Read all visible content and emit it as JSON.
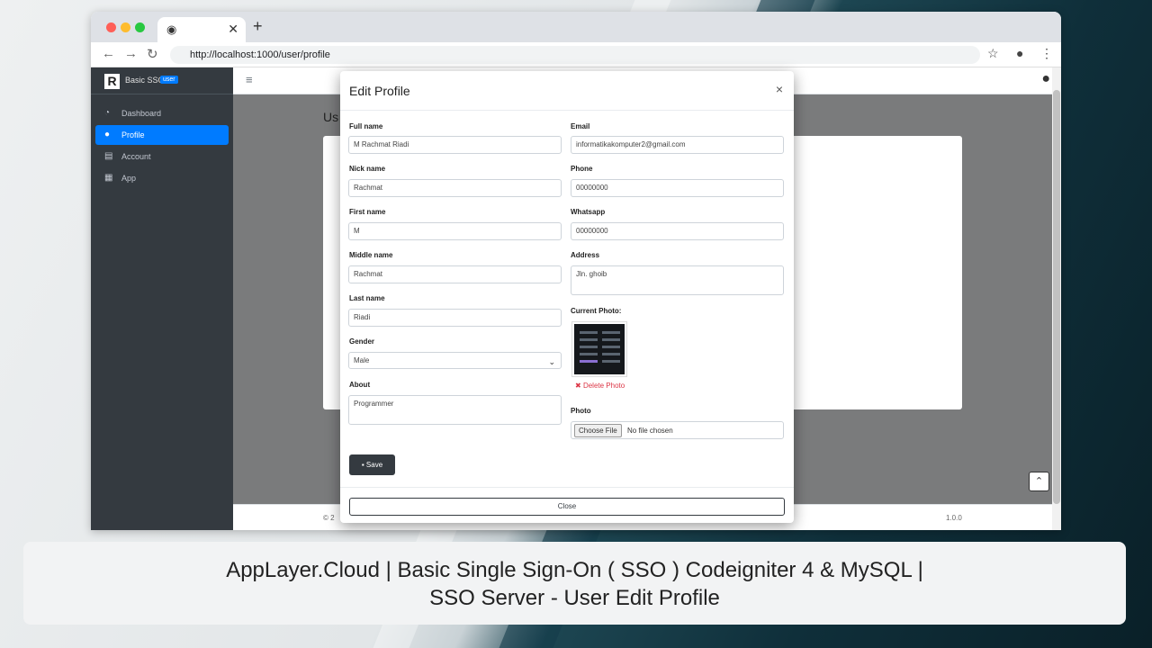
{
  "browser": {
    "url": "http://localhost:1000/user/profile"
  },
  "sidebar": {
    "brand_name": "Basic SSO",
    "brand_badge": "user",
    "items": [
      {
        "label": "Dashboard",
        "icon": "tachometer-icon"
      },
      {
        "label": "Profile",
        "icon": "user-icon"
      },
      {
        "label": "Account",
        "icon": "id-card-icon"
      },
      {
        "label": "App",
        "icon": "grid-icon"
      }
    ]
  },
  "background": {
    "page_title": "Us",
    "footer_left": "© 2",
    "version": "1.0.0"
  },
  "modal": {
    "title": "Edit Profile",
    "fields": {
      "full_name": {
        "label": "Full name",
        "value": "M Rachmat Riadi"
      },
      "nick_name": {
        "label": "Nick name",
        "value": "Rachmat"
      },
      "first_name": {
        "label": "First name",
        "value": "M"
      },
      "middle_name": {
        "label": "Middle name",
        "value": "Rachmat"
      },
      "last_name": {
        "label": "Last name",
        "value": "Riadi"
      },
      "gender": {
        "label": "Gender",
        "value": "Male"
      },
      "about": {
        "label": "About",
        "value": "Programmer"
      },
      "email": {
        "label": "Email",
        "value": "informatikakomputer2@gmail.com"
      },
      "phone": {
        "label": "Phone",
        "value": "00000000"
      },
      "whatsapp": {
        "label": "Whatsapp",
        "value": "00000000"
      },
      "address": {
        "label": "Address",
        "value": "Jln. ghoib"
      },
      "current_photo": {
        "label": "Current Photo:"
      },
      "delete_photo": "Delete Photo",
      "photo": {
        "label": "Photo",
        "button": "Choose File",
        "status": "No file chosen"
      }
    },
    "save_label": "Save",
    "close_label": "Close"
  },
  "caption": {
    "line1": "AppLayer.Cloud | Basic Single Sign-On ( SSO ) Codeigniter 4 & MySQL |",
    "line2": "SSO Server - User Edit Profile"
  },
  "colors": {
    "accent": "#007bff",
    "danger": "#dc3545",
    "sidebar": "#343a40"
  }
}
